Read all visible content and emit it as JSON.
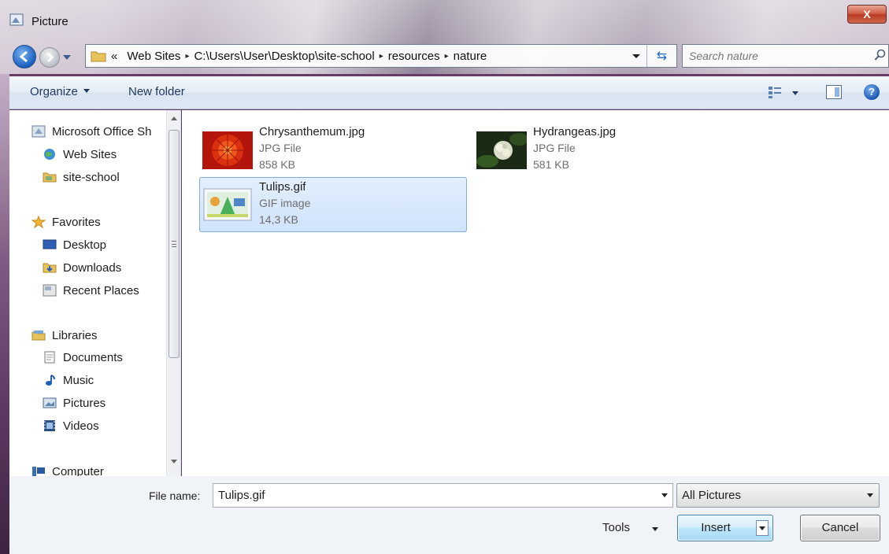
{
  "window": {
    "title": "Picture",
    "close_label": "X"
  },
  "address": {
    "overflow": "«",
    "segments": [
      "Web Sites",
      "C:\\Users\\User\\Desktop\\site-school",
      "resources",
      "nature"
    ],
    "separator": "▸"
  },
  "search": {
    "placeholder": "Search nature"
  },
  "toolbar": {
    "organize_label": "Organize",
    "new_folder_label": "New folder"
  },
  "nav": {
    "items": [
      {
        "label": "Microsoft Office Sh",
        "icon": "office-icon"
      },
      {
        "label": "Web Sites",
        "icon": "globe-icon"
      },
      {
        "label": "site-school",
        "icon": "folder-icon"
      },
      {
        "label": "Favorites",
        "icon": "star-icon"
      },
      {
        "label": "Desktop",
        "icon": "desktop-icon"
      },
      {
        "label": "Downloads",
        "icon": "downloads-icon"
      },
      {
        "label": "Recent Places",
        "icon": "recent-places-icon"
      },
      {
        "label": "Libraries",
        "icon": "libraries-icon"
      },
      {
        "label": "Documents",
        "icon": "documents-icon"
      },
      {
        "label": "Music",
        "icon": "music-icon"
      },
      {
        "label": "Pictures",
        "icon": "pictures-icon"
      },
      {
        "label": "Videos",
        "icon": "videos-icon"
      },
      {
        "label": "Computer",
        "icon": "computer-icon"
      }
    ]
  },
  "files": [
    {
      "name": "Chrysanthemum.jpg",
      "type": "JPG File",
      "size": "858 KB",
      "selected": false
    },
    {
      "name": "Hydrangeas.jpg",
      "type": "JPG File",
      "size": "581 KB",
      "selected": false
    },
    {
      "name": "Tulips.gif",
      "type": "GIF image",
      "size": "14,3 KB",
      "selected": true
    }
  ],
  "footer": {
    "file_name_label": "File name:",
    "file_name_value": "Tulips.gif",
    "filter_value": "All Pictures",
    "tools_label": "Tools",
    "insert_label": "Insert",
    "cancel_label": "Cancel"
  }
}
